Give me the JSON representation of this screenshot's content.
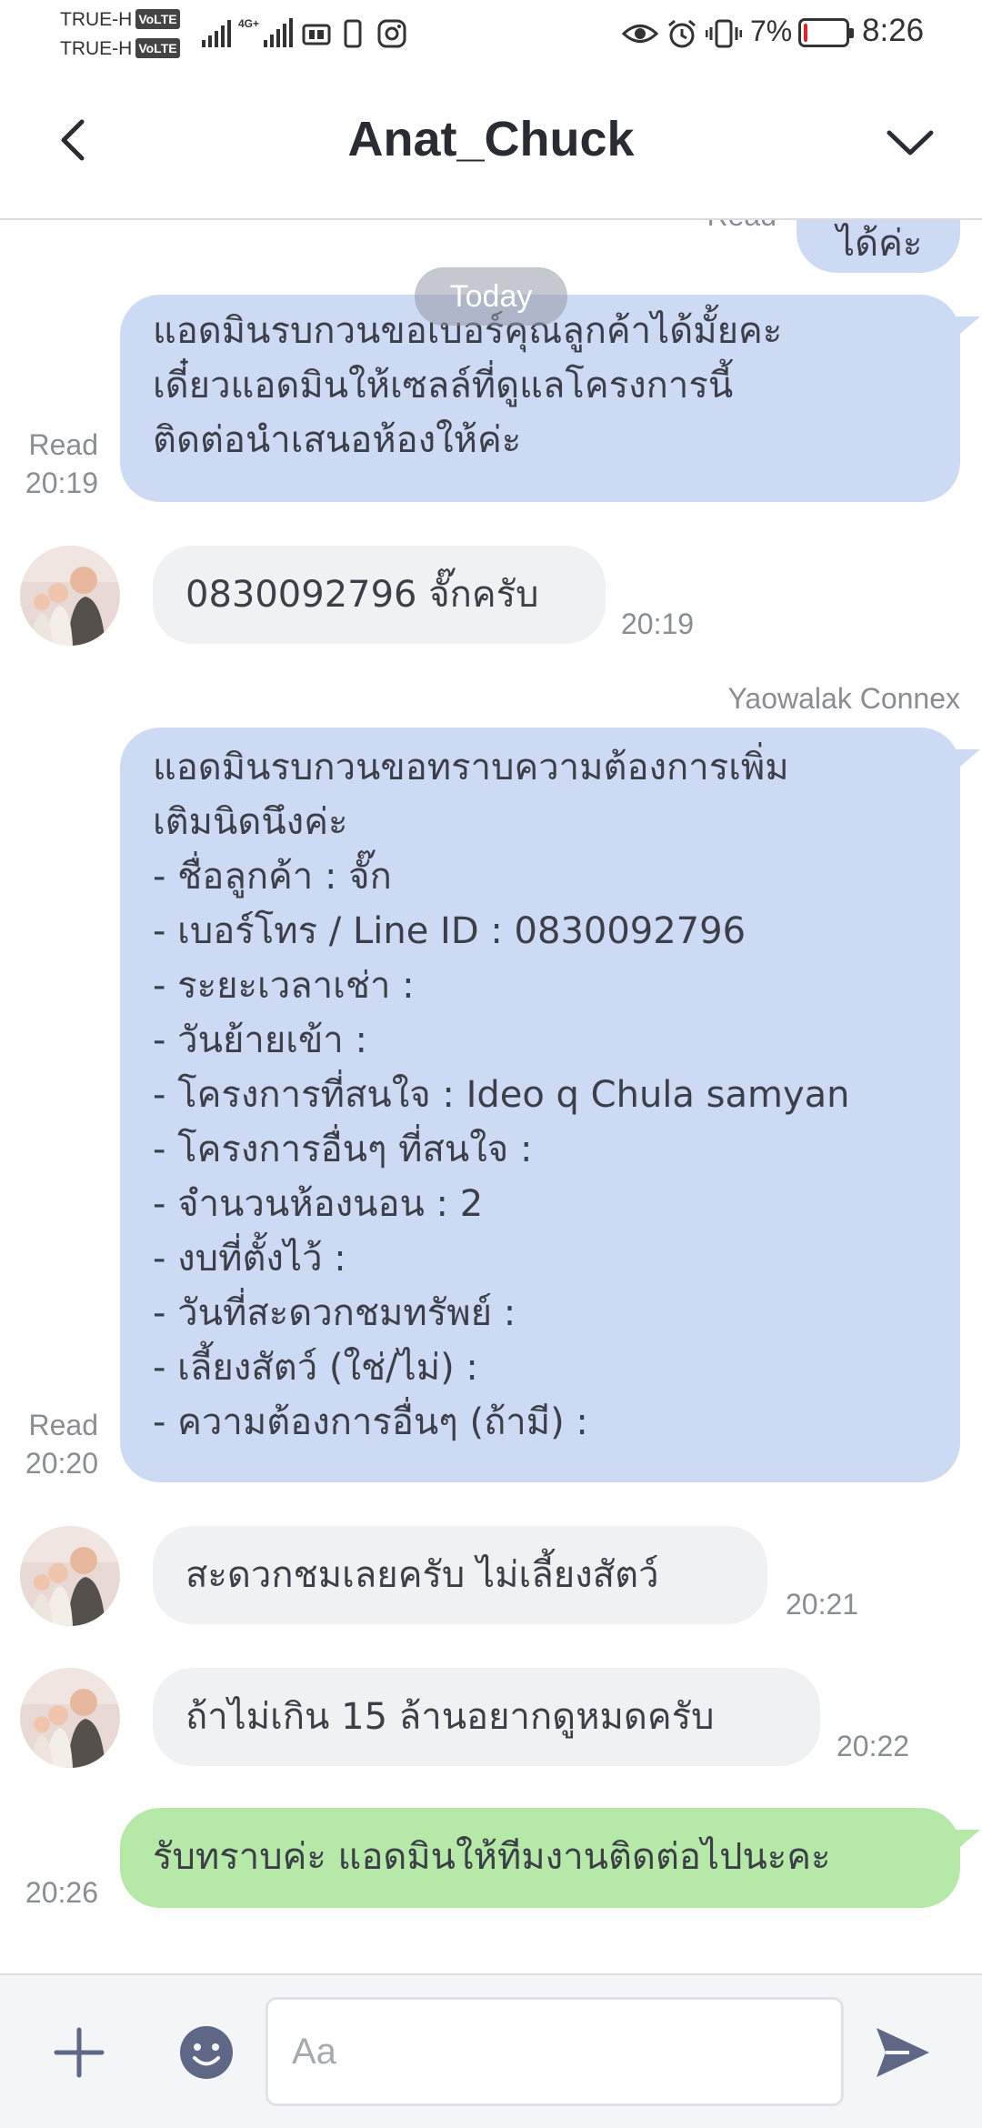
{
  "status_bar": {
    "carrier_1": "TRUE-H",
    "carrier_2": "TRUE-H",
    "volte": "VoLTE",
    "network": "4G+",
    "battery_percent": "7%",
    "battery_level": 0.07,
    "time": "8:26",
    "icons": [
      "signal-icon",
      "signal-4g-icon",
      "data-icon",
      "phone-icon",
      "instagram-icon",
      "eye-icon",
      "alarm-icon",
      "vibrate-icon",
      "battery-icon"
    ]
  },
  "header": {
    "title": "Anat_Chuck",
    "back_icon": "chevron-left-icon",
    "menu_icon": "chevron-down-icon"
  },
  "chat": {
    "partial_top": {
      "status": "Read",
      "text": "ได้ค่ะ"
    },
    "date_divider": "Today",
    "messages": [
      {
        "direction": "out",
        "status": "Read",
        "time": "20:19",
        "lines": [
          "แอดมินรบกวนขอเบอร์คุณลูกค้าได้มั้ยคะ",
          "เดี๋ยวแอดมินให้เซลล์ที่ดูแลโครงการนี้",
          "ติดต่อนำเสนอห้องให้ค่ะ"
        ]
      },
      {
        "direction": "in",
        "time": "20:19",
        "text": "0830092796 จั๊กครับ"
      },
      {
        "direction": "out",
        "sender": "Yaowalak Connex",
        "status": "Read",
        "time": "20:20",
        "lines": [
          "แอดมินรบกวนขอทราบความต้องการเพิ่ม",
          "เติมนิดนึงค่ะ",
          "- ชื่อลูกค้า : จั๊ก",
          "- เบอร์โทร / Line ID : 0830092796",
          "- ระยะเวลาเช่า :",
          "- วันย้ายเข้า :",
          "- โครงการที่สนใจ : Ideo q Chula samyan",
          "- โครงการอื่นๆ ที่สนใจ :",
          "- จำนวนห้องนอน : 2",
          "- งบที่ตั้งไว้ :",
          "- วันที่สะดวกชมทรัพย์ :",
          "- เลี้ยงสัตว์ (ใช่/ไม่) :",
          "- ความต้องการอื่นๆ (ถ้ามี) :"
        ]
      },
      {
        "direction": "in",
        "time": "20:21",
        "text": "สะดวกชมเลยครับ ไม่เลี้ยงสัตว์"
      },
      {
        "direction": "in",
        "time": "20:22",
        "text": "ถ้าไม่เกิน 15 ล้านอยากดูหมดครับ"
      },
      {
        "direction": "out",
        "time": "20:26",
        "text": "รับทราบค่ะ แอดมินให้ทีมงานติดต่อไปนะคะ"
      }
    ]
  },
  "input_bar": {
    "placeholder": "Aa",
    "value": "",
    "plus_icon": "plus-icon",
    "emoji_icon": "emoji-icon",
    "send_icon": "send-icon"
  },
  "colors": {
    "outgoing_bubble": "#ccdaf4",
    "outgoing_last_bubble": "#b6e8a8",
    "incoming_bubble": "#f0f1f3",
    "send_icon": "#5f6786"
  }
}
